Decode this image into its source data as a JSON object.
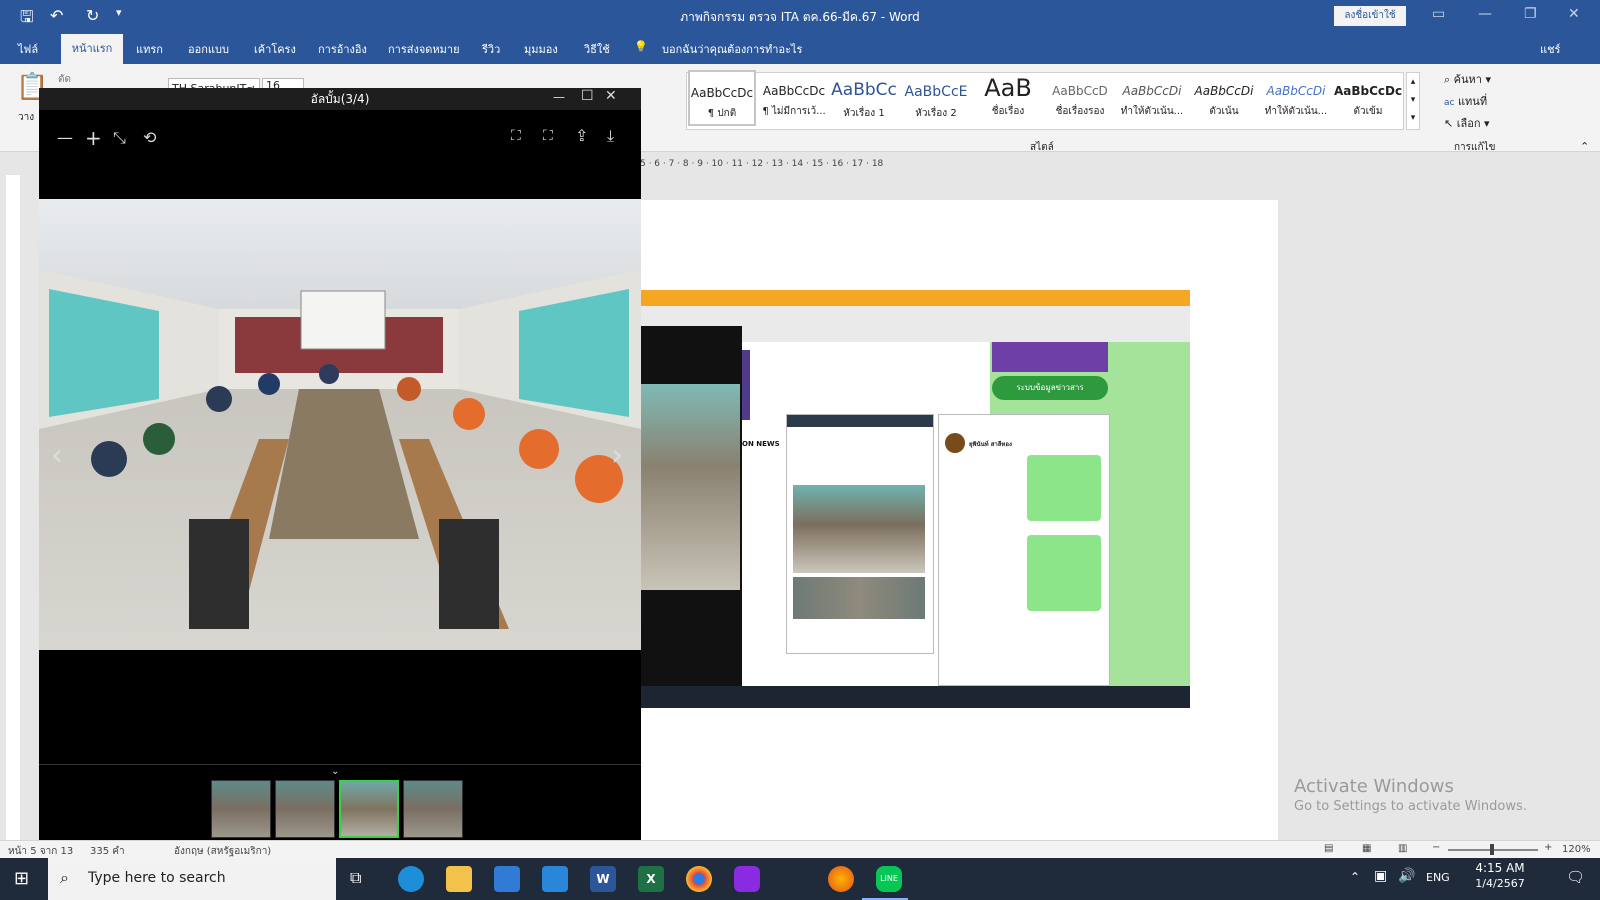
{
  "window": {
    "title": "ภาพกิจกรรม ตรวจ ITA ตค.66-มีค.67 - Word",
    "signin": "ลงชื่อเข้าใช้"
  },
  "ribbon": {
    "tabs": [
      "ไฟล์",
      "หน้าแรก",
      "แทรก",
      "ออกแบบ",
      "เค้าโครง",
      "การอ้างอิง",
      "การส่งจดหมาย",
      "รีวิว",
      "มุมมอง",
      "วิธีใช้"
    ],
    "active_tab": "หน้าแรก",
    "tell_me": "บอกฉันว่าคุณต้องการทำอะไร",
    "share": "แชร์",
    "clipboard_cut": "ตัด",
    "paste": "วาง",
    "font_name": "TH SarabunIT๙",
    "font_size": "16",
    "styles_group": "สไตล์",
    "editing_group": "การแก้ไข",
    "find": "ค้นหา",
    "replace": "แทนที่",
    "select": "เลือก",
    "styles": [
      {
        "sample": "AaBbCcDc",
        "name": "¶ ปกติ"
      },
      {
        "sample": "AaBbCcDc",
        "name": "¶ ไม่มีการเว้..."
      },
      {
        "sample": "AaBbCc",
        "name": "หัวเรื่อง 1"
      },
      {
        "sample": "AaBbCcE",
        "name": "หัวเรื่อง 2"
      },
      {
        "sample": "AaB",
        "name": "ชื่อเรื่อง"
      },
      {
        "sample": "AaBbCcD",
        "name": "ชื่อเรื่องรอง"
      },
      {
        "sample": "AaBbCcDi",
        "name": "ทำให้ตัวเน้น..."
      },
      {
        "sample": "AaBbCcDi",
        "name": "ตัวเน้น"
      },
      {
        "sample": "AaBbCcDi",
        "name": "ทำให้ตัวเน้น..."
      },
      {
        "sample": "AaBbCcDc",
        "name": "ตัวเข้ม"
      }
    ]
  },
  "ruler_marks": "5 · 6 · 7 · 8 · 9 · 10 · 11 · 12 · 13 · 14 · 15 · 16 · 17 · 18",
  "viewer": {
    "title": "อัลบั้ม(3/4)",
    "thumbnail_count": 4,
    "active_thumb": 3
  },
  "statusbar": {
    "page": "หน้า 5 จาก 13",
    "words": "335 คำ",
    "language": "อังกฤษ (สหรัฐอเมริกา)",
    "zoom": "120%"
  },
  "embedded": {
    "chat_contact": "ยุพินันท์ สาลีทอง",
    "ita_label": "ระบบข้อมูลข่าวสาร",
    "sidebar_headline": "ON NEWS"
  },
  "watermark": {
    "line1": "Activate Windows",
    "line2": "Go to Settings to activate Windows."
  },
  "taskbar": {
    "search_placeholder": "Type here to search",
    "lang": "ENG",
    "time": "4:15 AM",
    "date": "1/4/2567"
  }
}
